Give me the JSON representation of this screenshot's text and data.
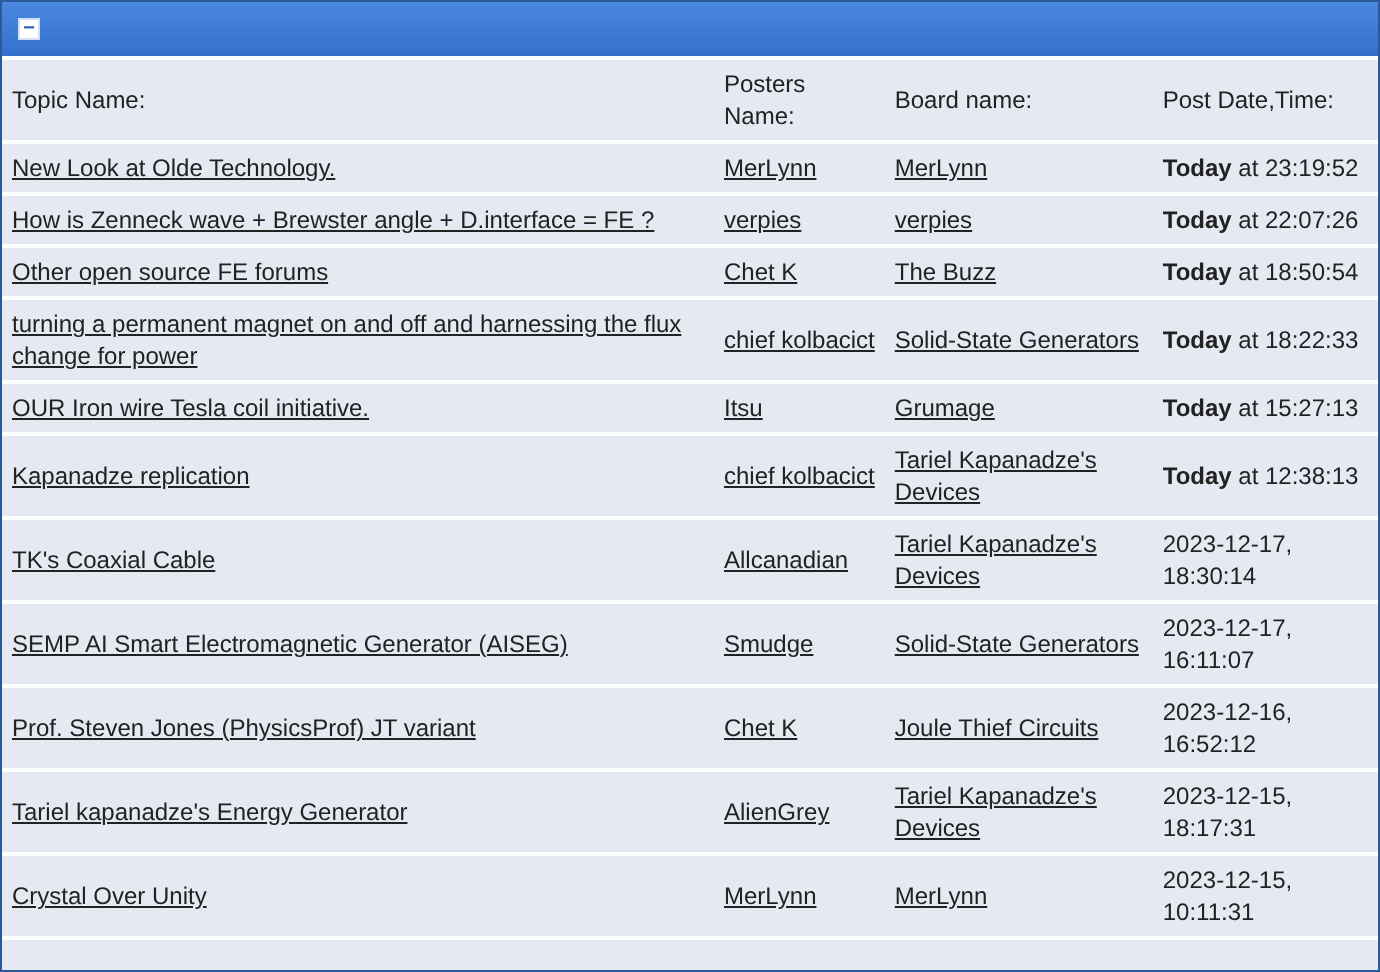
{
  "panel": {
    "collapse_button": {
      "label": "−"
    }
  },
  "table": {
    "columns": [
      "Topic Name:",
      "Posters Name:",
      "Board name:",
      "Post Date,Time:"
    ],
    "rows": [
      {
        "topic": "New Look at Olde Technology.",
        "poster": "MerLynn",
        "board": "MerLynn",
        "date": "**Today** at 23:19:52"
      },
      {
        "topic": "How is Zenneck wave + Brewster angle + D.interface = FE ?",
        "poster": "verpies",
        "board": "verpies",
        "date": "**Today** at 22:07:26"
      },
      {
        "topic": "Other open source FE forums",
        "poster": "Chet K",
        "board": "The Buzz",
        "date": "**Today** at 18:50:54"
      },
      {
        "topic": "turning a permanent magnet on and off and harnessing the flux change for power",
        "poster": "chief kolbacict",
        "board": "Solid-State Generators",
        "date": "**Today** at 18:22:33"
      },
      {
        "topic": "OUR Iron wire Tesla coil initiative.",
        "poster": "Itsu",
        "board": "Grumage",
        "date": "**Today** at 15:27:13"
      },
      {
        "topic": "Kapanadze replication",
        "poster": "chief kolbacict",
        "board": "Tariel Kapanadze's Devices",
        "date": "**Today** at 12:38:13"
      },
      {
        "topic": "TK's Coaxial Cable",
        "poster": "Allcanadian",
        "board": "Tariel Kapanadze's Devices",
        "date": "2023-12-17, 18:30:14"
      },
      {
        "topic": "SEMP AI Smart Electromagnetic Generator (AISEG)",
        "poster": "Smudge",
        "board": "Solid-State Generators",
        "date": "2023-12-17, 16:11:07"
      },
      {
        "topic": "Prof. Steven Jones (PhysicsProf) JT variant",
        "poster": "Chet K",
        "board": "Joule Thief Circuits",
        "date": "2023-12-16, 16:52:12"
      },
      {
        "topic": "Tariel kapanadze's Energy Generator",
        "poster": "AlienGrey",
        "board": "Tariel Kapanadze's Devices",
        "date": "2023-12-15, 18:17:31"
      },
      {
        "topic": "Crystal Over Unity",
        "poster": "MerLynn",
        "board": "MerLynn",
        "date": "2023-12-15, 10:11:31"
      }
    ]
  }
}
